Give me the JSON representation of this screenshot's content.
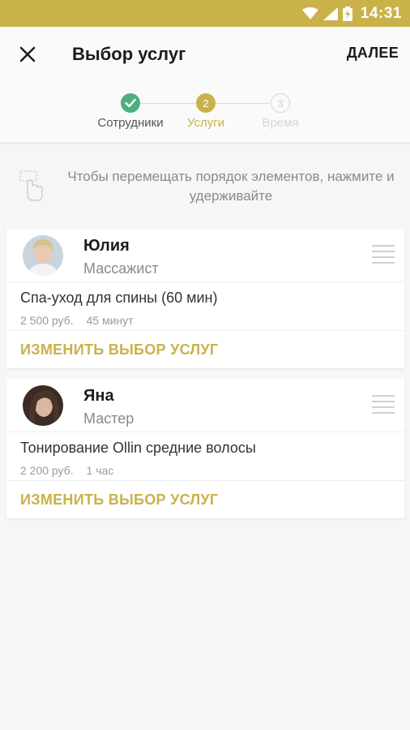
{
  "status_bar": {
    "time": "14:31"
  },
  "header": {
    "title": "Выбор услуг",
    "next_label": "ДАЛЕЕ"
  },
  "stepper": {
    "steps": [
      {
        "number": "1",
        "label": "Сотрудники",
        "state": "done"
      },
      {
        "number": "2",
        "label": "Услуги",
        "state": "active"
      },
      {
        "number": "3",
        "label": "Время",
        "state": "inactive"
      }
    ]
  },
  "hint": {
    "text": "Чтобы перемещать порядок элементов, нажмите и удерживайте"
  },
  "employees": [
    {
      "name": "Юлия",
      "role": "Массажист",
      "service": {
        "name": "Спа-уход для спины (60 мин)",
        "price": "2 500 руб.",
        "duration": "45 минут"
      },
      "change_label": "ИЗМЕНИТЬ ВЫБОР УСЛУГ"
    },
    {
      "name": "Яна",
      "role": "Мастер",
      "service": {
        "name": "Тонирование Ollin средние волосы",
        "price": "2 200 руб.",
        "duration": "1 час"
      },
      "change_label": "ИЗМЕНИТЬ ВЫБОР УСЛУГ"
    }
  ],
  "colors": {
    "accent": "#c9b24a",
    "success": "#4caf7d",
    "inactive": "#d6d6d6"
  }
}
